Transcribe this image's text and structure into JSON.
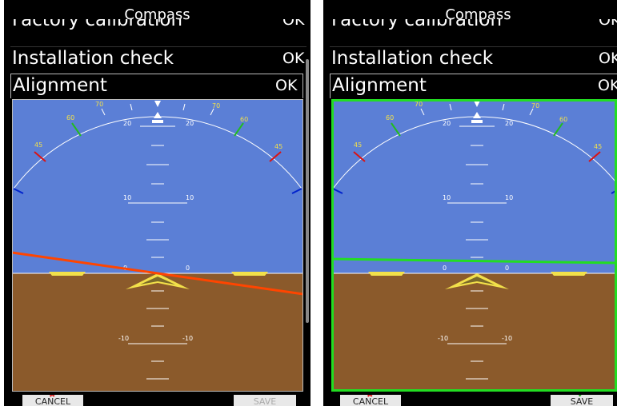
{
  "screen_title": "Compass",
  "rows": {
    "factory": {
      "label": "Factory calibration",
      "status": "OK"
    },
    "install": {
      "label": "Installation check",
      "status": "OK"
    },
    "align": {
      "label": "Alignment",
      "status": "OK"
    }
  },
  "buttons": {
    "cancel": "CANCEL",
    "save": "SAVE"
  },
  "bank_labels": [
    "70",
    "60",
    "45",
    "20"
  ],
  "pitch_labels": [
    "20",
    "10",
    "0",
    "-10"
  ],
  "colors": {
    "sky": "#5b7fd6",
    "ground": "#8b5a2b",
    "misaligned_line": "#ff4500",
    "aligned_line": "#22dd22",
    "marker": "#f2e04a"
  }
}
